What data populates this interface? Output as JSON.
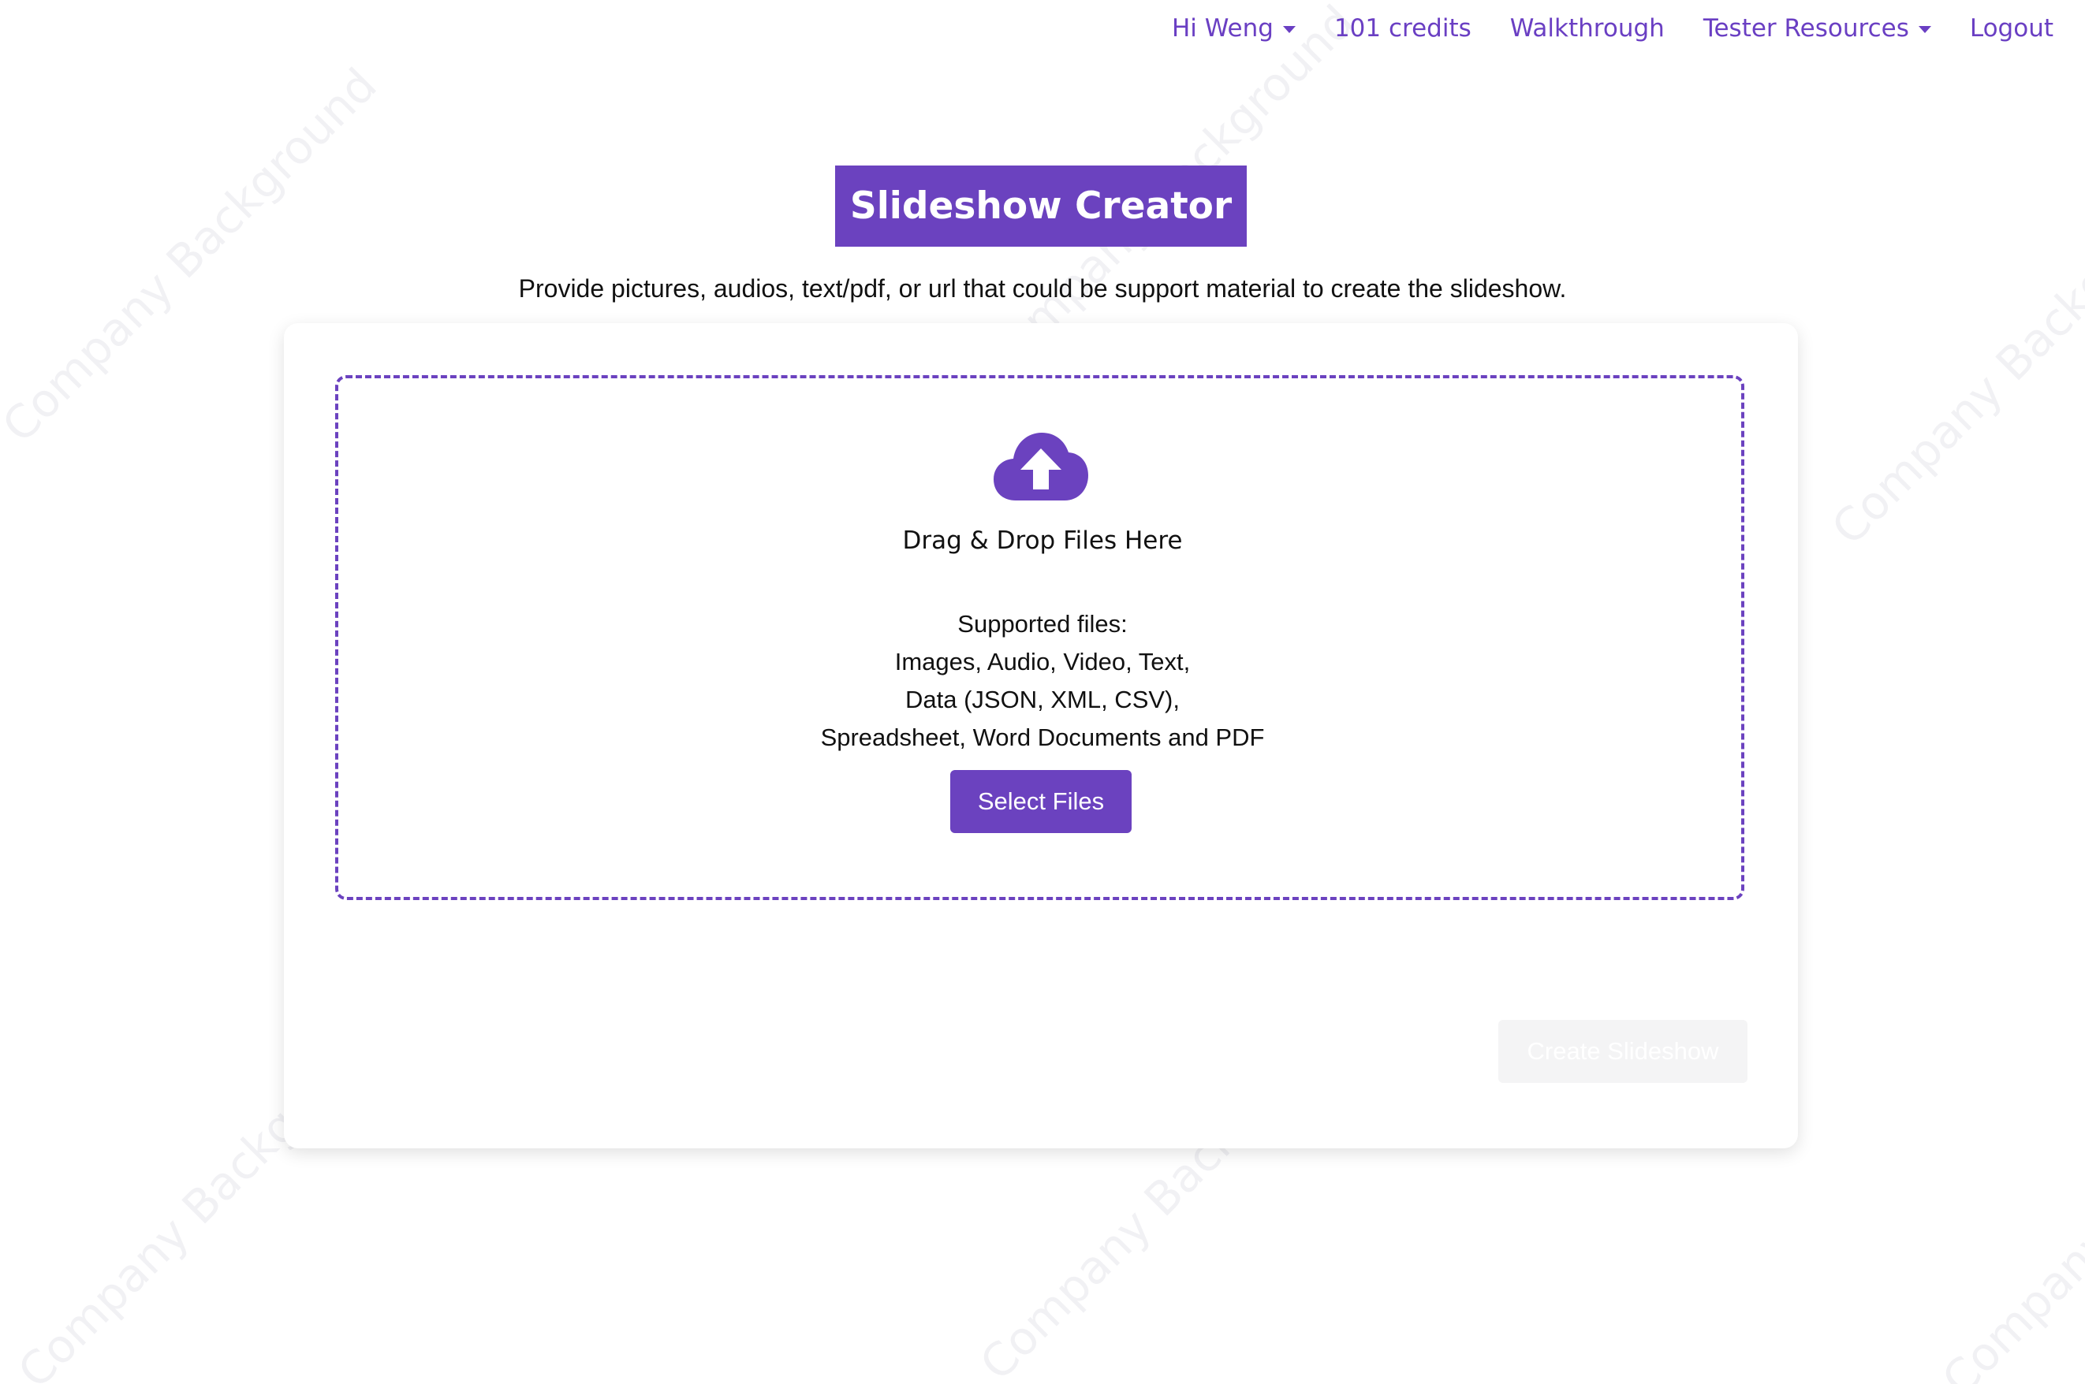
{
  "nav": {
    "user_menu": "Hi Weng",
    "credits": "101 credits",
    "walkthrough": "Walkthrough",
    "tester_resources": "Tester Resources",
    "logout": "Logout"
  },
  "header": {
    "title": "Slideshow Creator",
    "subtitle": "Provide pictures, audios, text/pdf, or url that could be support material to create the slideshow."
  },
  "dropzone": {
    "drag_label": "Drag & Drop Files Here",
    "supported_lines": [
      "Supported files:",
      "Images, Audio, Video, Text,",
      "Data (JSON, XML, CSV),",
      "Spreadsheet, Word Documents and PDF"
    ],
    "select_button": "Select Files",
    "icon": "cloud-upload-icon"
  },
  "actions": {
    "create_button": "Create Slideshow",
    "create_disabled": true
  },
  "watermark": {
    "text": "Company Background"
  },
  "colors": {
    "accent": "#6b42bf",
    "nav_link": "#6a3fc3",
    "disabled_bg": "#f4f4f5"
  }
}
